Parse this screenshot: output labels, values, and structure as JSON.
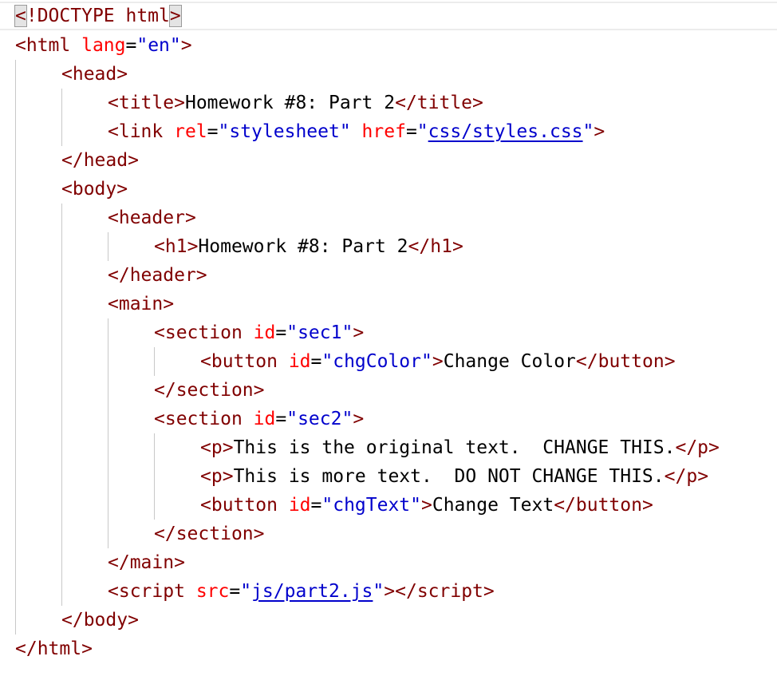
{
  "colors": {
    "tag": "#800000",
    "attr": "#ff0000",
    "string": "#0000cc",
    "text": "#000000"
  },
  "code": {
    "doctype": "!DOCTYPE html",
    "html_open": "html",
    "html_lang_attr": "lang",
    "html_lang_val": "\"en\"",
    "head_open": "head",
    "title_open": "title",
    "title_text": "Homework #8: Part 2",
    "title_close": "/title",
    "link_open": "link",
    "link_rel_attr": "rel",
    "link_rel_val": "\"stylesheet\"",
    "link_href_attr": "href",
    "link_href_val": "css/styles.css",
    "head_close": "/head",
    "body_open": "body",
    "header_open": "header",
    "h1_open": "h1",
    "h1_text": "Homework #8: Part 2",
    "h1_close": "/h1",
    "header_close": "/header",
    "main_open": "main",
    "section1_open": "section",
    "section1_id_attr": "id",
    "section1_id_val": "\"sec1\"",
    "button1_open": "button",
    "button1_id_attr": "id",
    "button1_id_val": "\"chgColor\"",
    "button1_text": "Change Color",
    "button1_close": "/button",
    "section1_close": "/section",
    "section2_open": "section",
    "section2_id_attr": "id",
    "section2_id_val": "\"sec2\"",
    "p1_open": "p",
    "p1_text": "This is the original text.  CHANGE THIS.",
    "p1_close": "/p",
    "p2_open": "p",
    "p2_text": "This is more text.  DO NOT CHANGE THIS.",
    "p2_close": "/p",
    "button2_open": "button",
    "button2_id_attr": "id",
    "button2_id_val": "\"chgText\"",
    "button2_text": "Change Text",
    "button2_close": "/button",
    "section2_close": "/section",
    "main_close": "/main",
    "script_open": "script",
    "script_src_attr": "src",
    "script_src_val": "js/part2.js",
    "script_close": "/script",
    "body_close": "/body",
    "html_close": "/html"
  }
}
